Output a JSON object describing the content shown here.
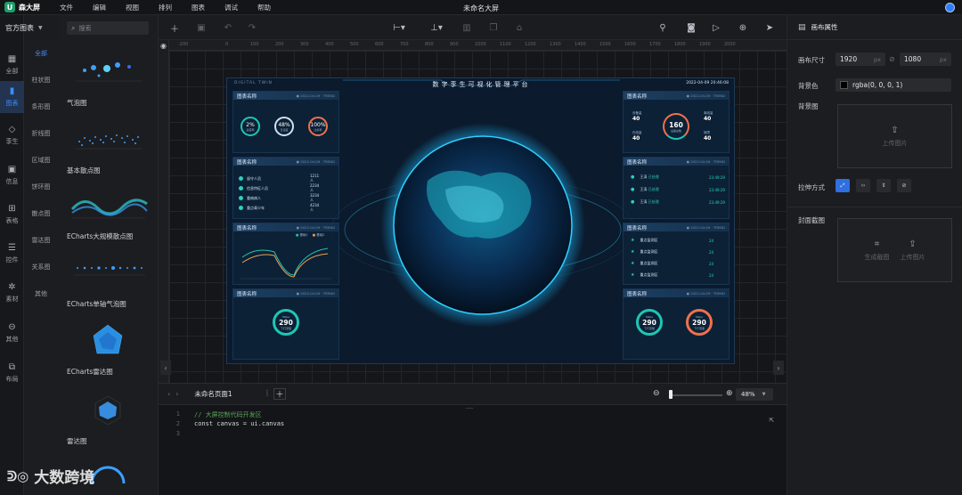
{
  "app": {
    "name": "森大屏",
    "logo_letter": "U",
    "document_title": "未命名大屏",
    "menu": [
      "文件",
      "编辑",
      "视图",
      "排列",
      "图表",
      "调试",
      "帮助"
    ]
  },
  "left_rail": {
    "header": "官方图表",
    "items": [
      {
        "label": "全部",
        "icon": "grid-icon"
      },
      {
        "label": "图表",
        "icon": "bar-chart-icon",
        "active": true
      },
      {
        "label": "孪生",
        "icon": "cube-icon"
      },
      {
        "label": "信息",
        "icon": "info-icon"
      },
      {
        "label": "表格",
        "icon": "table-icon"
      },
      {
        "label": "控件",
        "icon": "control-icon"
      },
      {
        "label": "素材",
        "icon": "material-icon"
      },
      {
        "label": "其他",
        "icon": "more-icon"
      },
      {
        "label": "布局",
        "icon": "layout-icon"
      }
    ]
  },
  "categories": [
    "全部",
    "柱状图",
    "条形图",
    "折线图",
    "区域图",
    "饼环图",
    "散点图",
    "雷达图",
    "关系图",
    "其他"
  ],
  "search": {
    "placeholder": "搜索"
  },
  "components": [
    {
      "label": "气泡图"
    },
    {
      "label": "基本散点图"
    },
    {
      "label": "ECharts大规模散点图"
    },
    {
      "label": "ECharts单轴气泡图"
    },
    {
      "label": "ECharts雷达图"
    },
    {
      "label": "雷达图"
    }
  ],
  "canvas": {
    "ruler_ticks": [
      "-200",
      "0",
      "100",
      "200",
      "300",
      "400",
      "500",
      "600",
      "700",
      "800",
      "900",
      "1000",
      "1100",
      "1200",
      "1300",
      "1400",
      "1500",
      "1600",
      "1700",
      "1800",
      "1900",
      "2000"
    ]
  },
  "dashboard": {
    "brand": "DIGITAL TWIN",
    "title": "数字孪生可视化管理平台",
    "time": "2022-04-09 20:46:08",
    "panel_title": "图表名称",
    "panel_meta": "● 2022-04-09 · TREND",
    "rings": [
      {
        "value": "2",
        "unit": "%",
        "label": "运营率",
        "color": "#1fc6b4"
      },
      {
        "value": "48",
        "unit": "%",
        "label": "日活度",
        "color": "#cfe0f3"
      },
      {
        "value": "100",
        "unit": "%",
        "label": "达标率",
        "color": "#f0704c"
      }
    ],
    "rows": [
      {
        "label": "留守人员",
        "value": "1211人"
      },
      {
        "label": "信息特征人员",
        "value": "2234人"
      },
      {
        "label": "重病病人",
        "value": "3234人"
      },
      {
        "label": "重点青少年",
        "value": "4234人"
      }
    ],
    "line_chart": {
      "legend": [
        "基础1",
        "基础2"
      ]
    },
    "right_stats": [
      {
        "label": "设备量",
        "value": "40"
      },
      {
        "label": "在线量",
        "value": "40"
      },
      {
        "label": "离线量",
        "value": "40"
      },
      {
        "label": "故障",
        "value": "40"
      },
      {
        "label": "设备总数",
        "value": "160"
      }
    ],
    "events": [
      {
        "name": "王涛",
        "status": "已处理",
        "time": "23:49:29"
      },
      {
        "name": "王涛",
        "status": "已处理",
        "time": "23:49:29"
      },
      {
        "name": "王涛",
        "status": "已处理",
        "time": "23:49:29"
      }
    ],
    "areas": [
      {
        "label": "重点监测区",
        "value": "24"
      },
      {
        "label": "重点监测区",
        "value": "24"
      },
      {
        "label": "重点监测区",
        "value": "24"
      },
      {
        "label": "重点监测区",
        "value": "24"
      }
    ],
    "gauges": [
      {
        "value": "290",
        "unit": "Mbps",
        "label": "下行流量",
        "color": "#1fc6b4"
      },
      {
        "value": "290",
        "unit": "Mbps",
        "label": "下行流量",
        "color": "#1fc6b4"
      },
      {
        "value": "290",
        "unit": "Mbps",
        "label": "下行流量",
        "color": "#f0704c"
      }
    ]
  },
  "page_tabs": {
    "active": "未命名页面1"
  },
  "zoom": {
    "value": "48%"
  },
  "code": {
    "lines": [
      {
        "no": "1",
        "text": "// 大屏控制代码开发区",
        "comment": true
      },
      {
        "no": "2",
        "text": "const canvas = ui.canvas",
        "comment": false
      },
      {
        "no": "3",
        "text": "",
        "comment": false
      }
    ]
  },
  "right_panel": {
    "title": "画布属性",
    "size_label": "画布尺寸",
    "width": "1920",
    "height": "1080",
    "unit": "px",
    "bg_color_label": "背景色",
    "bg_color_value": "rgba(0, 0, 0, 1)",
    "bg_image_label": "背景图",
    "upload_label": "上传图片",
    "fill_label": "拉伸方式",
    "cover_label": "封面截图",
    "generate_label": "生成截图",
    "upload_label2": "上传图片"
  },
  "watermark": "大数跨境",
  "colors": {
    "accent": "#3d8bfd",
    "teal": "#1fc6b4",
    "orange": "#f0704c"
  }
}
